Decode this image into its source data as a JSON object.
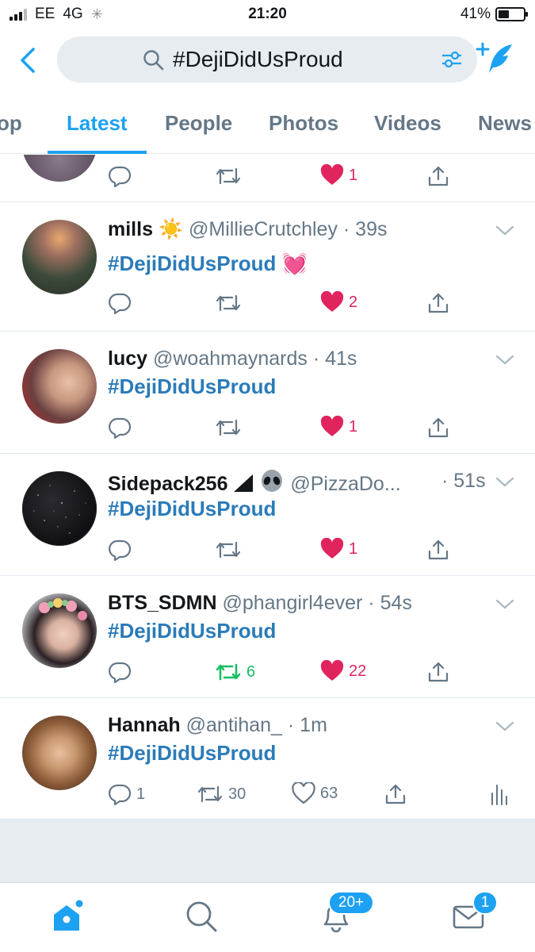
{
  "status_bar": {
    "carrier": "EE",
    "network": "4G",
    "time": "21:20",
    "battery": "41%"
  },
  "search": {
    "query": "#DejiDidUsProud"
  },
  "tabs": [
    {
      "label": "Top"
    },
    {
      "label": "Latest"
    },
    {
      "label": "People"
    },
    {
      "label": "Photos"
    },
    {
      "label": "Videos"
    },
    {
      "label": "News"
    }
  ],
  "tabs_visible": {
    "top_partial": "op"
  },
  "partial_tweet": {
    "likes": "1"
  },
  "tweets": [
    {
      "name": "mills",
      "handle": "@MillieCrutchley",
      "time": "39s",
      "text": "#DejiDidUsProud",
      "emoji_after_name": "☀️",
      "emoji_after_text": "💓",
      "replies": "",
      "retweets": "",
      "likes": "2"
    },
    {
      "name": "lucy",
      "handle": "@woahmaynards",
      "time": "41s",
      "text": "#DejiDidUsProud",
      "replies": "",
      "retweets": "",
      "likes": "1"
    },
    {
      "name": "Sidepack256",
      "handle": "@PizzaDo...",
      "time": "51s",
      "text": "#DejiDidUsProud",
      "replies": "",
      "retweets": "",
      "likes": "1"
    },
    {
      "name": "BTS_SDMN",
      "handle": "@phangirl4ever",
      "time": "54s",
      "text": "#DejiDidUsProud",
      "replies": "",
      "retweets": "6",
      "likes": "22"
    },
    {
      "name": "Hannah",
      "handle": "@antihan_",
      "time": "1m",
      "text": "#DejiDidUsProud",
      "replies": "1",
      "retweets": "30",
      "likes": "63"
    }
  ],
  "bottom_nav": {
    "notifications_badge": "20+",
    "messages_badge": "1"
  },
  "colors": {
    "accent": "#1da1f2",
    "hashtag": "#2b7bb9",
    "like": "#e0245e",
    "retweet": "#17bf63",
    "muted": "#657786"
  }
}
